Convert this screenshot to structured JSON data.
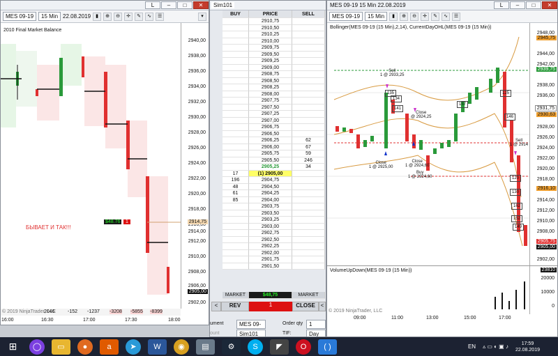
{
  "left_chart": {
    "title_tab": "L",
    "instrument": "MES 09-19",
    "interval": "15 Min",
    "date": "22.08.2019",
    "indicator_label": "2010 Final Market Balance",
    "annotation": "БЫВАЕТ И ТАК!!!",
    "position_qty": "$48.76",
    "position_count": "1",
    "position_price": "2914,75",
    "last_price": "2905,00",
    "y_ticks": [
      "2940,00",
      "2938,00",
      "2936,00",
      "2934,00",
      "2932,00",
      "2930,00",
      "2928,00",
      "2926,00",
      "2924,00",
      "2922,00",
      "2920,00",
      "2918,00",
      "2916,00",
      "2914,00",
      "2912,00",
      "2910,00",
      "2908,00",
      "2906,00",
      "2904,00",
      "2902,00"
    ],
    "delta_values": [
      "-152",
      "-1237",
      "-3208",
      "-5855",
      "-8399"
    ],
    "delta_partial": "2046",
    "x_ticks": [
      "16:00",
      "16:30",
      "17:00",
      "17:30",
      "18:00"
    ],
    "copyright": "© 2019 NinjaTrader, LLC"
  },
  "dom": {
    "account_tab": "Sim101",
    "headers": {
      "buy": "BUY",
      "price": "PRICE",
      "sell": "SELL"
    },
    "rows": [
      {
        "buy": "",
        "price": "2910,75",
        "sell": ""
      },
      {
        "buy": "",
        "price": "2910,50",
        "sell": ""
      },
      {
        "buy": "",
        "price": "2910,25",
        "sell": ""
      },
      {
        "buy": "",
        "price": "2910,00",
        "sell": ""
      },
      {
        "buy": "",
        "price": "2909,75",
        "sell": ""
      },
      {
        "buy": "",
        "price": "2909,50",
        "sell": ""
      },
      {
        "buy": "",
        "price": "2909,25",
        "sell": ""
      },
      {
        "buy": "",
        "price": "2909,00",
        "sell": ""
      },
      {
        "buy": "",
        "price": "2908,75",
        "sell": ""
      },
      {
        "buy": "",
        "price": "2908,50",
        "sell": ""
      },
      {
        "buy": "",
        "price": "2908,25",
        "sell": ""
      },
      {
        "buy": "",
        "price": "2908,00",
        "sell": ""
      },
      {
        "buy": "",
        "price": "2907,75",
        "sell": ""
      },
      {
        "buy": "",
        "price": "2907,50",
        "sell": ""
      },
      {
        "buy": "",
        "price": "2907,25",
        "sell": ""
      },
      {
        "buy": "",
        "price": "2907,00",
        "sell": ""
      },
      {
        "buy": "",
        "price": "2906,75",
        "sell": ""
      },
      {
        "buy": "",
        "price": "2906,50",
        "sell": ""
      },
      {
        "buy": "",
        "price": "2906,25",
        "sell": "62"
      },
      {
        "buy": "",
        "price": "2906,00",
        "sell": "67"
      },
      {
        "buy": "",
        "price": "2905,75",
        "sell": "59"
      },
      {
        "buy": "",
        "price": "2905,50",
        "sell": "246"
      },
      {
        "buy": "",
        "price": "2905,25",
        "sell": "34"
      },
      {
        "buy": "17",
        "price": "(1) 2905,00",
        "sell": ""
      },
      {
        "buy": "196",
        "price": "2904,75",
        "sell": ""
      },
      {
        "buy": "48",
        "price": "2904,50",
        "sell": ""
      },
      {
        "buy": "61",
        "price": "2904,25",
        "sell": ""
      },
      {
        "buy": "85",
        "price": "2904,00",
        "sell": ""
      },
      {
        "buy": "",
        "price": "2903,75",
        "sell": ""
      },
      {
        "buy": "",
        "price": "2903,50",
        "sell": ""
      },
      {
        "buy": "",
        "price": "2903,25",
        "sell": ""
      },
      {
        "buy": "",
        "price": "2903,00",
        "sell": ""
      },
      {
        "buy": "",
        "price": "2902,75",
        "sell": ""
      },
      {
        "buy": "",
        "price": "2902,50",
        "sell": ""
      },
      {
        "buy": "",
        "price": "2902,25",
        "sell": ""
      },
      {
        "buy": "",
        "price": "2902,00",
        "sell": ""
      },
      {
        "buy": "",
        "price": "2901,75",
        "sell": ""
      },
      {
        "buy": "",
        "price": "2901,50",
        "sell": ""
      }
    ],
    "market_buy": "MARKET",
    "pnl": "$48,75",
    "market_sell": "MARKET",
    "rev_label": "REV",
    "position": "1",
    "close_label": "CLOSE",
    "instrument_label": "ument",
    "instrument_value": "MES 09-1!",
    "order_qty_label": "Order qty",
    "order_qty_value": "1",
    "account_label": "ount",
    "account_value": "Sim101",
    "tif_label": "TIF:",
    "tif_value": "Day"
  },
  "right_chart": {
    "instrument": "MES 09-19",
    "interval": "15 Min",
    "date": "22.08.2019",
    "title_tab": "L",
    "indicator_label": "Bollinger(MES 09-19 (15 Min),2,14), CurrentDayOHL(MES 09-19 (15 Min))",
    "volume_label": "VolumeUpDown(MES 09-19 (15 Min))",
    "volume_value": "23810",
    "volume_ticks": [
      "20000",
      "10000",
      "0"
    ],
    "y_ticks": [
      "2948,00",
      "2946,00",
      "2944,00",
      "2942,00",
      "2940,00",
      "2938,00",
      "2936,00",
      "2934,00",
      "2932,00",
      "2930,00",
      "2928,00",
      "2926,00",
      "2924,00",
      "2922,00",
      "2920,00",
      "2918,00",
      "2916,00",
      "2914,00",
      "2912,00",
      "2910,00",
      "2908,00",
      "2906,00",
      "2904,00",
      "2902,00"
    ],
    "price_tags": [
      {
        "label": "2945,75",
        "color": "#f0a030"
      },
      {
        "label": "2939,75",
        "color": "#2a9a3a"
      },
      {
        "label": "2931,75",
        "color": "#ffffff"
      },
      {
        "label": "2930,63",
        "color": "#f0a030"
      },
      {
        "label": "2916,10",
        "color": "#f0a030"
      },
      {
        "label": "2905,75",
        "color": "#e03030"
      },
      {
        "label": "2905,00",
        "color": "#111111"
      }
    ],
    "trade_labels": [
      {
        "text": "Sell\n1 @ 2933,25"
      },
      {
        "text": "Close\n@ 2924,25"
      },
      {
        "text": "Close\n1 @ 2925,00"
      },
      {
        "text": "Close\n1 @ 2924,60"
      },
      {
        "text": "Buy\n1 @ 2924,60"
      },
      {
        "text": "Sell\n1 @ 2914"
      }
    ],
    "bar_labels": [
      "135",
      "134",
      "141",
      "157",
      "125",
      "146",
      "120",
      "130",
      "162",
      "152",
      "149"
    ],
    "x_ticks": [
      "09:00",
      "11:00",
      "13:00",
      "15:00",
      "17:00"
    ],
    "copyright": "© 2019 NinjaTrader, LLC"
  },
  "taskbar": {
    "lang": "EN",
    "time": "17:59",
    "date": "22.08.2019",
    "apps": [
      "start",
      "alice",
      "explorer",
      "firefox",
      "avast",
      "telegram",
      "word",
      "chrome",
      "notepad",
      "steam",
      "skype",
      "ninja",
      "opera",
      "bracket"
    ]
  },
  "colors": {
    "up": "#2a9a3a",
    "down": "#e03030",
    "dom_highlight": "#ffff66",
    "pnl_bg": "#1a1a1a",
    "pnl_text": "#22ee22",
    "position_bg": "#dd1111"
  }
}
